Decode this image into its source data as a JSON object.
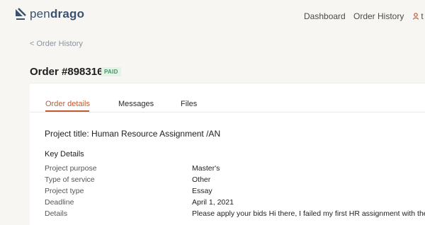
{
  "brand": {
    "name_light": "pen",
    "name_bold": "drago",
    "color": "#3a5170"
  },
  "nav": {
    "dashboard": "Dashboard",
    "order_history": "Order History",
    "user_initial": "t"
  },
  "back_link": "< Order History",
  "order": {
    "title": "Order #898316",
    "status": "PAID"
  },
  "tabs": [
    {
      "label": "Order details",
      "active": true
    },
    {
      "label": "Messages",
      "active": false
    },
    {
      "label": "Files",
      "active": false
    }
  ],
  "project_title": "Project title: Human Resource Assignment /AN",
  "key_details": {
    "heading": "Key Details",
    "rows": [
      {
        "label": "Project purpose",
        "value": "Master's"
      },
      {
        "label": "Type of service",
        "value": "Other"
      },
      {
        "label": "Project type",
        "value": "Essay"
      },
      {
        "label": "Deadline",
        "value": "April 1, 2021"
      },
      {
        "label": "Details",
        "value": "Please apply your bids Hi there, I failed my first HR assignment with the"
      }
    ]
  },
  "colors": {
    "accent": "#c25a2f",
    "paid_bg": "#e3f3e7",
    "paid_text": "#3a9a5a"
  }
}
